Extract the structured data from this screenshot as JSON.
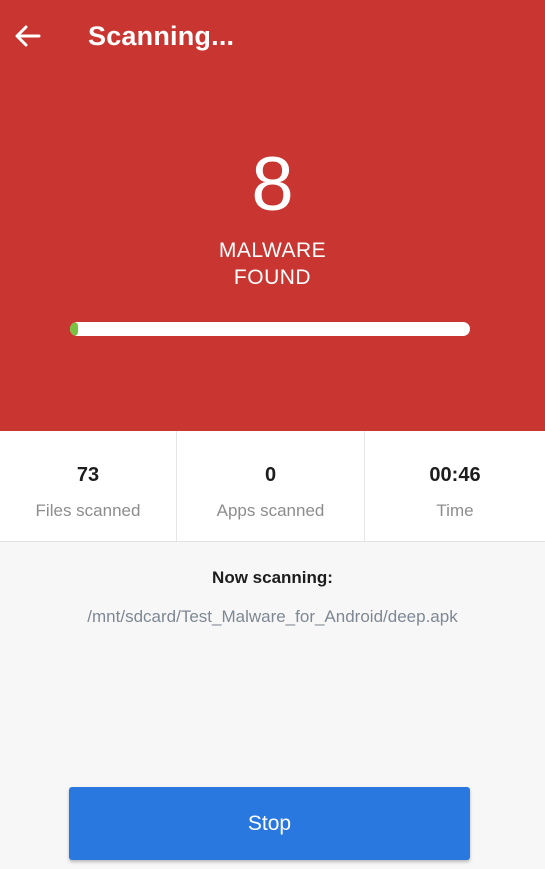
{
  "header": {
    "title": "Scanning...",
    "back_icon": "arrow-left-icon"
  },
  "result": {
    "malware_count": "8",
    "label_line1": "MALWARE",
    "label_line2": "FOUND"
  },
  "progress": {
    "fraction": 0.02
  },
  "stats": [
    {
      "value": "73",
      "label": "Files scanned"
    },
    {
      "value": "0",
      "label": "Apps scanned"
    },
    {
      "value": "00:46",
      "label": "Time"
    }
  ],
  "now_scanning": {
    "heading": "Now scanning:",
    "path": "/mnt/sdcard/Test_Malware_for_Android/deep.apk"
  },
  "actions": {
    "stop_label": "Stop"
  },
  "colors": {
    "header_bg": "#c93631",
    "progress_fill": "#7ac142",
    "stop_button": "#2878df"
  }
}
